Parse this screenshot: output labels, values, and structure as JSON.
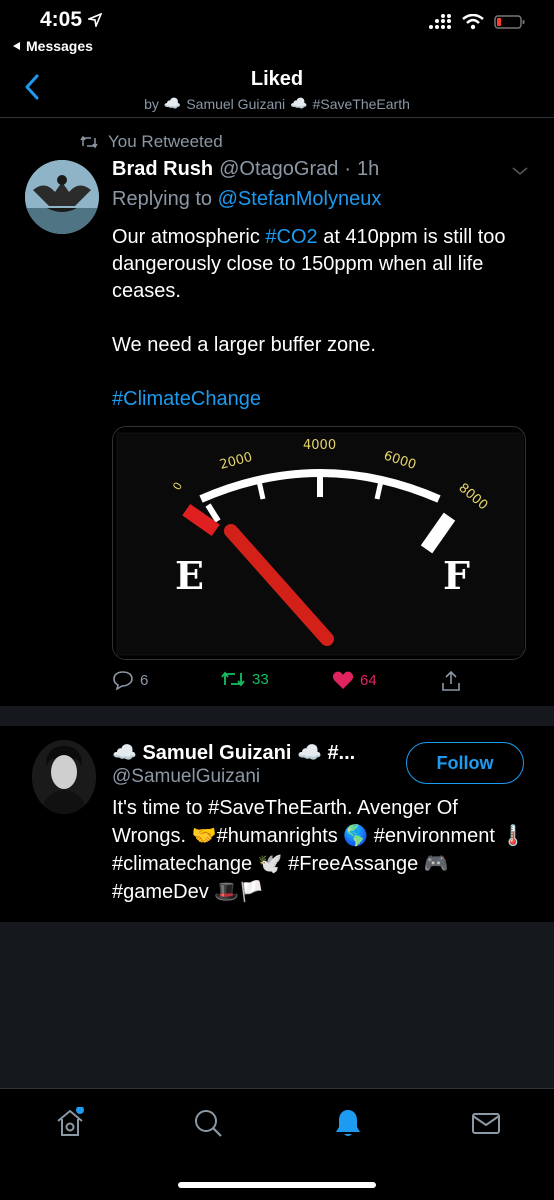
{
  "status": {
    "time": "4:05",
    "back_label": "Messages"
  },
  "header": {
    "title": "Liked",
    "by": "by",
    "subtitle": "Samuel Guizani",
    "hashtag": "#SaveTheEarth"
  },
  "tweet": {
    "retweet_label": "You Retweeted",
    "name": "Brad Rush",
    "handle": "@OtagoGrad",
    "dot": "·",
    "time": "1h",
    "replying_to_label": "Replying to",
    "replying_to_handle": "@StefanMolyneux",
    "text_line1_a": "Our atmospheric ",
    "text_hashtag_co2": "#CO2",
    "text_line1_b": " at 410ppm is still too dangerously close to 150ppm when all life ceases.",
    "text_line2": "We need a larger buffer zone.",
    "text_hashtag_climate": "#ClimateChange",
    "gauge": {
      "labels": [
        "0",
        "2000",
        "4000",
        "6000",
        "8000"
      ],
      "empty_letter": "E",
      "full_letter": "F"
    },
    "actions": {
      "replies": "6",
      "retweets": "33",
      "likes": "64"
    },
    "colors": {
      "retweet": "#17bf63",
      "like": "#e0245e",
      "link": "#1d9bf0"
    }
  },
  "user_card": {
    "name": "Samuel Guizani",
    "name_suffix": "#...",
    "handle": "@SamuelGuizani",
    "follow_label": "Follow",
    "bio_1": "It's time to #SaveTheEarth. Avenger Of Wrongs. ",
    "bio_2": "#humanrights ",
    "bio_3": "#environment ",
    "bio_4": "#climatechange ",
    "bio_5": "#FreeAssange ",
    "bio_6": "#gameDev "
  },
  "tabbar": {
    "tabs": [
      "home-icon",
      "search-icon",
      "notifications-icon",
      "messages-icon"
    ],
    "active": "notifications-icon"
  }
}
